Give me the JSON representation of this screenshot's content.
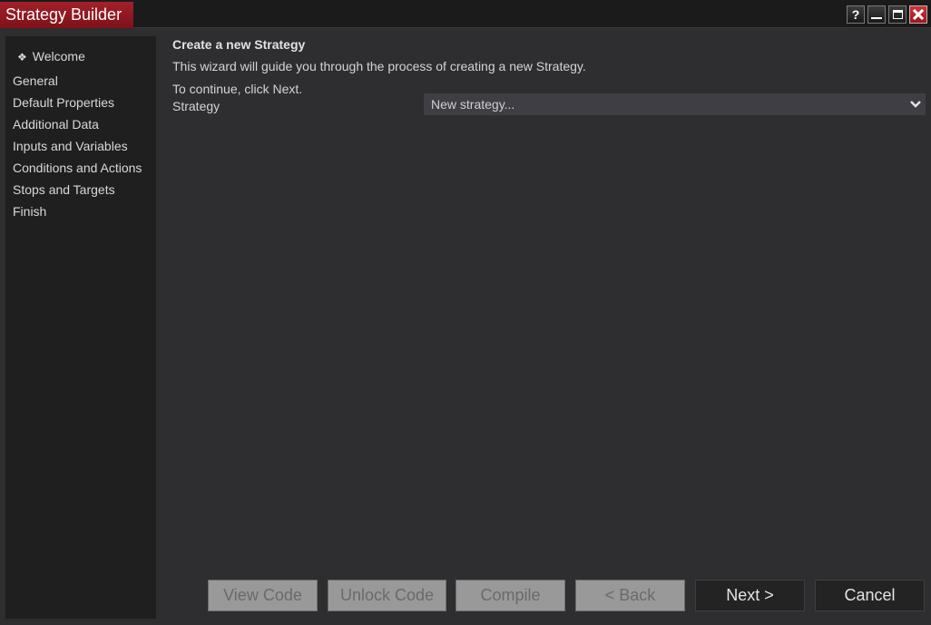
{
  "window": {
    "title": "Strategy Builder",
    "controls": {
      "help": "?",
      "minimize": "minimize",
      "maximize": "maximize",
      "close": "close"
    }
  },
  "sidebar": {
    "active_marker": "❖",
    "items": [
      {
        "label": "Welcome",
        "active": true
      },
      {
        "label": "General",
        "active": false
      },
      {
        "label": "Default Properties",
        "active": false
      },
      {
        "label": "Additional Data",
        "active": false
      },
      {
        "label": "Inputs and Variables",
        "active": false
      },
      {
        "label": "Conditions and Actions",
        "active": false
      },
      {
        "label": "Stops and Targets",
        "active": false
      },
      {
        "label": "Finish",
        "active": false
      }
    ]
  },
  "main": {
    "heading": "Create a new Strategy",
    "description": "This wizard will guide you through the process of creating a new Strategy.",
    "instruction": "To continue, click Next.",
    "strategy_field": {
      "label": "Strategy",
      "value": "New strategy..."
    }
  },
  "buttons": {
    "view_code": {
      "label": "View Code",
      "enabled": false
    },
    "unlock_code": {
      "label": "Unlock Code",
      "enabled": false
    },
    "compile": {
      "label": "Compile",
      "enabled": false
    },
    "back": {
      "label": "< Back",
      "enabled": false
    },
    "next": {
      "label": "Next >",
      "enabled": true
    },
    "cancel": {
      "label": "Cancel",
      "enabled": true
    }
  },
  "colors": {
    "title_accent": "#a4202a",
    "background": "#2e2e31",
    "sidebar": "#1f1f1f",
    "dropdown": "#403e45",
    "disabled_button": "#999999"
  }
}
